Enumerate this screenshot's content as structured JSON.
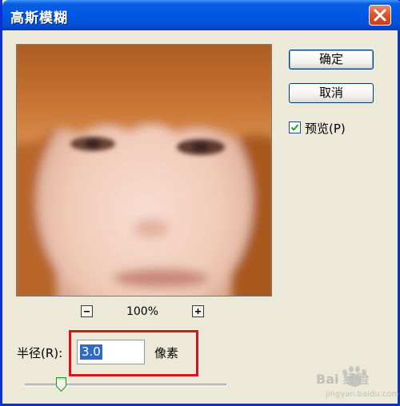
{
  "window": {
    "title": "高斯模糊",
    "close_icon": "close-icon"
  },
  "buttons": {
    "ok_label": "确定",
    "cancel_label": "取消"
  },
  "preview": {
    "checked": true,
    "label": "预览(P)"
  },
  "zoom": {
    "level": "100%",
    "zoom_out_icon": "minus-icon",
    "zoom_in_icon": "plus-icon"
  },
  "radius": {
    "label": "半径(R):",
    "value": "3.0",
    "unit": "像素",
    "slider_fraction": 0.18
  },
  "watermark": {
    "text": "Bai 经验",
    "subtext": "jingyan.baidu.com"
  },
  "colors": {
    "titlebar": "#0058e6",
    "highlight": "#e0101a",
    "selection": "#316ac5",
    "dialog_bg": "#ece9d8"
  }
}
